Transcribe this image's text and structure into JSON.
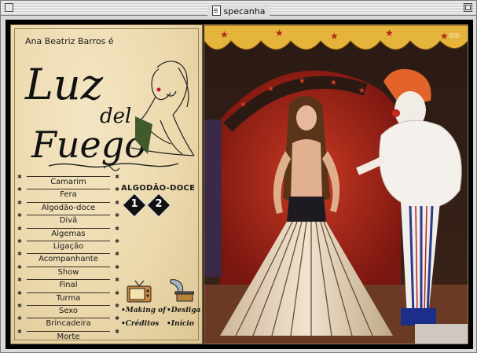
{
  "window": {
    "title": "specanha"
  },
  "left_panel": {
    "subtitle": "Ana Beatriz Barros é",
    "logo": {
      "line1": "Luz",
      "line2": "del",
      "line3": "Fuego"
    }
  },
  "menu": {
    "items": [
      "Camarim",
      "Fera",
      "Algodão-doce",
      "Divã",
      "Algemas",
      "Ligação",
      "Acompanhante",
      "Show",
      "Final",
      "Turma",
      "Sexo",
      "Brincadeira",
      "Morte"
    ]
  },
  "section": {
    "label": "ALGODÃO-DOCE",
    "pages": [
      "1",
      "2"
    ]
  },
  "links": {
    "making_of": "•Making of",
    "desliga": "•Desliga",
    "creditos": "•Créditos",
    "inicio": "•Início"
  },
  "icons": [
    "tv-icon",
    "gramophone-icon",
    "doc-icon",
    "close-box-icon",
    "zoom-box-icon"
  ],
  "colors": {
    "paper": "#ecd9ad",
    "curtain_red": "#b2261a",
    "frame": "#000000"
  }
}
